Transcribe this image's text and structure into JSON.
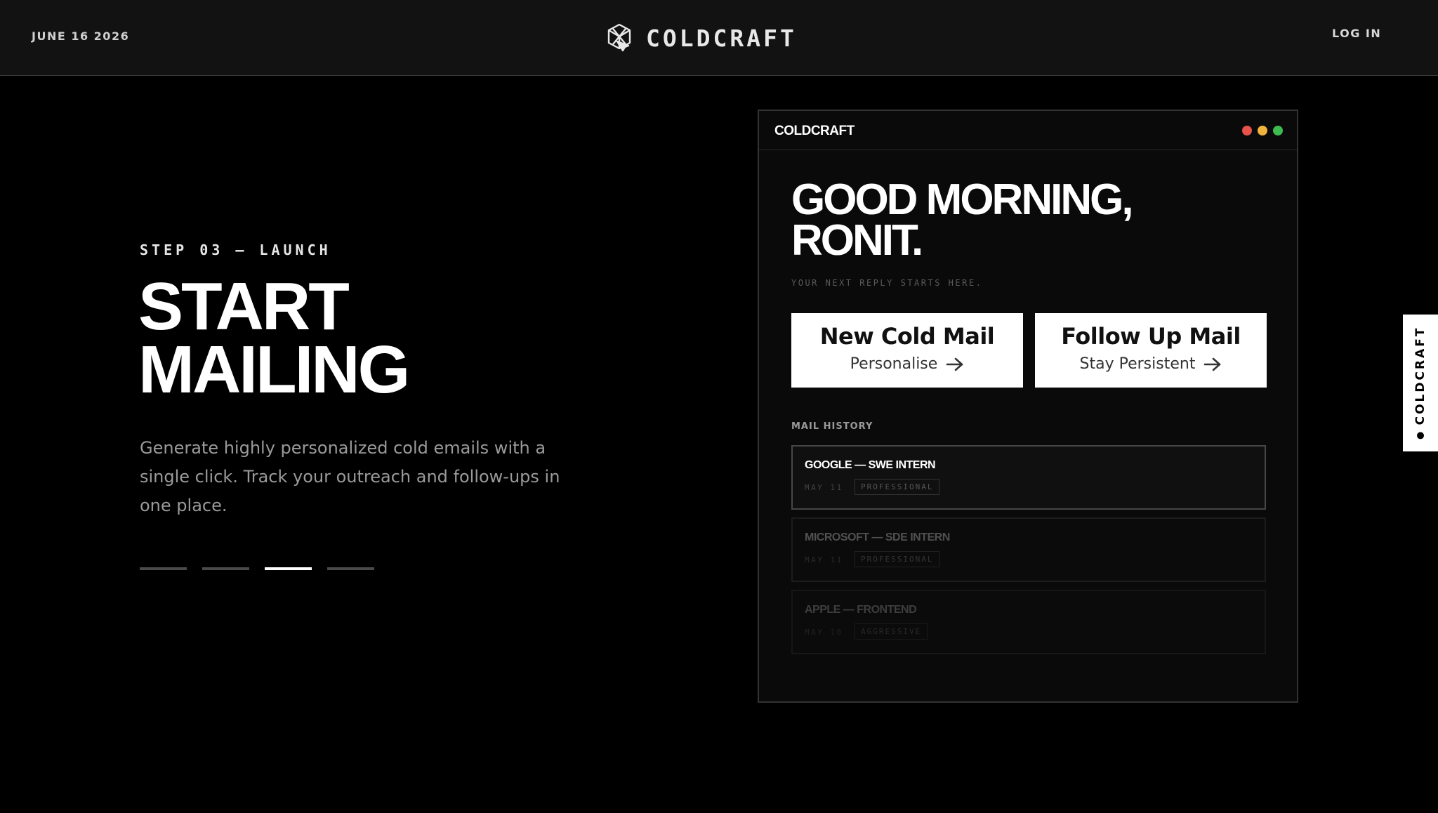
{
  "header": {
    "date": "JUNE 16 2026",
    "brand": "COLDCRAFT",
    "login_label": "LOG IN",
    "logo_icon": "coldcraft-logo-icon"
  },
  "hero": {
    "step": "STEP 03 — LAUNCH",
    "title_line1": "START",
    "title_line2": "MAILING",
    "description": "Generate highly personalized cold emails with a single click. Track your outreach and follow-ups in one place.",
    "carousel": {
      "total": 4,
      "active_index": 2
    }
  },
  "app": {
    "brand": "COLDCRAFT",
    "traffic_colors": [
      "#e5534b",
      "#f0b43c",
      "#3dbb4f"
    ],
    "greeting_line1": "GOOD MORNING,",
    "greeting_line2": "RONIT.",
    "subtitle": "YOUR NEXT REPLY STARTS HERE.",
    "actions": [
      {
        "title": "New Cold Mail",
        "subtitle": "Personalise",
        "icon": "arrow-right-icon"
      },
      {
        "title": "Follow Up Mail",
        "subtitle": "Stay Persistent",
        "icon": "arrow-right-icon"
      }
    ],
    "history_label": "MAIL HISTORY",
    "history": [
      {
        "title": "GOOGLE — SWE INTERN",
        "date": "MAY 11",
        "tag": "PROFESSIONAL"
      },
      {
        "title": "MICROSOFT — SDE INTERN",
        "date": "MAY 11",
        "tag": "PROFESSIONAL"
      },
      {
        "title": "APPLE — FRONTEND",
        "date": "MAY 10",
        "tag": "AGGRESSIVE"
      }
    ]
  },
  "sidetab": {
    "label": "COLDCRAFT"
  }
}
